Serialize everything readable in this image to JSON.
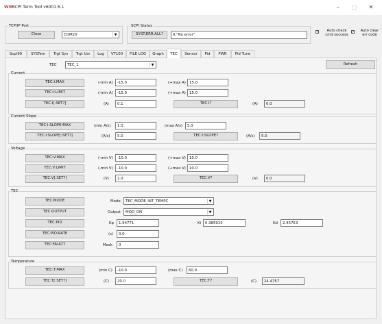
{
  "window": {
    "title": "SCPI Term Tool v6001.6.1",
    "minimize": "–",
    "maximize": "□",
    "close": "✕"
  },
  "tcp": {
    "group_title": "TCP/IP Port",
    "close_label": "Close",
    "port_value": "COM20"
  },
  "scpi_status": {
    "group_title": "SCPI Status",
    "button_label": "SYST:ERR:ALL?",
    "value": "0,\"No error\""
  },
  "options": {
    "auto_check_label": "Auto check cmd success",
    "auto_clear_label": "Auto clear err code"
  },
  "tabs": [
    {
      "label": "Scpi99"
    },
    {
      "label": "SYSTem"
    },
    {
      "label": "Trgt Sys"
    },
    {
      "label": "Trgt Usr"
    },
    {
      "label": "Log"
    },
    {
      "label": "VT100"
    },
    {
      "label": "FILE LOG"
    },
    {
      "label": "Graph"
    },
    {
      "label": "TEC"
    },
    {
      "label": "Sensor"
    },
    {
      "label": "Pid"
    },
    {
      "label": "PWR"
    },
    {
      "label": "Pid Tune"
    }
  ],
  "tec_select": {
    "label": "TEC",
    "value": "TEC_1",
    "refresh_label": "Refresh"
  },
  "current": {
    "title": "Current",
    "max_btn": "TEC:I:MAX",
    "max_min_label": "(-min A)",
    "max_min_value": "-15.0",
    "max_max_label": "(+max A)",
    "max_max_value": "15.0",
    "limit_btn": "TEC:I:LIMIT",
    "limit_min_label": "(-min A)",
    "limit_min_value": "-15.0",
    "limit_max_label": "(+max A)",
    "limit_max_value": "15.0",
    "set_btn": "TEC:I[:SET?]",
    "set_unit": "(A)",
    "set_value": "0.1",
    "query_btn": "TEC:I?",
    "query_unit": "(A)",
    "query_value": "0.0"
  },
  "slope": {
    "title": "Current Slope",
    "max_btn": "TEC:I:SLOPE:MAX",
    "min_label": "(min A/s)",
    "min_value": "1.0",
    "max_label": "(max A/s)",
    "max_value": "5.0",
    "set_btn": "TEC:I:SLOPE[:SET?]",
    "set_unit": "(A/s)",
    "set_value": "5.0",
    "query_btn": "TEC:I:SLOPE?",
    "query_unit": "(A/s)",
    "query_value": "5.0"
  },
  "voltage": {
    "title": "Voltage",
    "max_btn": "TEC:V:MAX",
    "max_min_label": "(-min V)",
    "max_min_value": "-10.0",
    "max_max_label": "(+max V)",
    "max_max_value": "10.0",
    "limit_btn": "TEC:V:LIMIT",
    "limit_min_label": "(-min V)",
    "limit_min_value": "-10.0",
    "limit_max_label": "(+max V)",
    "limit_max_value": "10.0",
    "set_btn": "TEC:V[:SET?]",
    "set_unit": "(V)",
    "set_value": "2.0",
    "query_btn": "TEC:V?",
    "query_unit": "(V)",
    "query_value": "0.0"
  },
  "tec": {
    "title": "TEC",
    "mode_btn": "TEC:MODE",
    "mode_label": "Mode",
    "mode_value": "TEC_MODE_INT_TEMPC",
    "output_btn": "TEC:OUTPUT",
    "output_label": "Output",
    "output_value": "MOD_ON",
    "pid_btn": "TEC:PID",
    "kp_label": "Kp",
    "kp_value": "1.94771",
    "ki_label": "Ki",
    "ki_value": "0.385915",
    "kd_label": "Kd",
    "kd_value": "2.45753",
    "rate_btn": "TEC:PID:RATE",
    "rate_unit": "(s)",
    "rate_value": "0.0",
    "fault_btn": "TEC:FAULT?",
    "mask_label": "Mask",
    "mask_value": "0"
  },
  "temperature": {
    "title": "Temperature",
    "max_btn": "TEC:T:MAX",
    "min_label": "(min C)",
    "min_value": "-10.0",
    "max_label": "(max C)",
    "max_value": "60.0",
    "set_btn": "TEC:T[:SET?]",
    "set_unit": "(C)",
    "set_value": "20.0",
    "query_btn": "TEC:T?",
    "query_unit": "(C)",
    "query_value": "24.4757"
  }
}
